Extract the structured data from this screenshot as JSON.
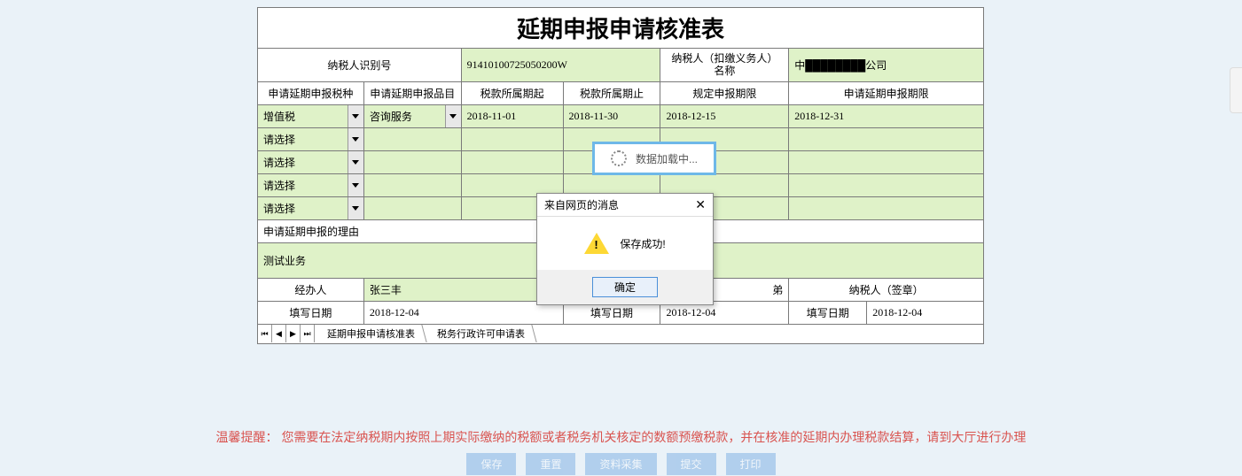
{
  "title": "延期申报申请核准表",
  "info": {
    "taxpayer_id_label": "纳税人识别号",
    "taxpayer_id_value": "91410100725050200W",
    "taxpayer_name_label": "纳税人（扣缴义务人）名称",
    "taxpayer_name_value": "中████████公司"
  },
  "headers": {
    "tax_type": "申请延期申报税种",
    "tax_item": "申请延期申报品目",
    "period_start": "税款所属期起",
    "period_end": "税款所属期止",
    "deadline": "规定申报期限",
    "extended_deadline": "申请延期申报期限"
  },
  "rows": [
    {
      "tax_type": "增值税",
      "tax_item": "咨询服务",
      "period_start": "2018-11-01",
      "period_end": "2018-11-30",
      "deadline": "2018-12-15",
      "extended_deadline": "2018-12-31"
    },
    {
      "tax_type": "请选择",
      "tax_item": "",
      "period_start": "",
      "period_end": "",
      "deadline": "",
      "extended_deadline": ""
    },
    {
      "tax_type": "请选择",
      "tax_item": "",
      "period_start": "",
      "period_end": "",
      "deadline": "",
      "extended_deadline": ""
    },
    {
      "tax_type": "请选择",
      "tax_item": "",
      "period_start": "",
      "period_end": "",
      "deadline": "",
      "extended_deadline": ""
    },
    {
      "tax_type": "请选择",
      "tax_item": "",
      "period_start": "",
      "period_end": "",
      "deadline": "",
      "extended_deadline": ""
    }
  ],
  "reason": {
    "label": "申请延期申报的理由",
    "value": "测试业务"
  },
  "handlers": {
    "operator_label": "经办人",
    "operator_value": "张三丰",
    "third_label": "弟",
    "fill_date_label": "填写日期",
    "taxpayer_sign_label": "纳税人（签章）",
    "date1": "2018-12-04",
    "date2_label": "填写日期",
    "date2": "2018-12-04",
    "date3_label": "填写日期",
    "date3": "2018-12-04"
  },
  "tabs": {
    "tab1": "延期申报申请核准表",
    "tab2": "税务行政许可申请表"
  },
  "reminder": {
    "label": "温馨提醒：",
    "text": "您需要在法定纳税期内按照上期实际缴纳的税额或者税务机关核定的数额预缴税款，并在核准的延期内办理税款结算，请到大厅进行办理"
  },
  "buttons": {
    "save": "保存",
    "reset": "重置",
    "collect": "资料采集",
    "submit": "提交",
    "print": "打印"
  },
  "loading": "数据加载中...",
  "dialog": {
    "title": "来自网页的消息",
    "message": "保存成功!",
    "ok": "确定"
  }
}
